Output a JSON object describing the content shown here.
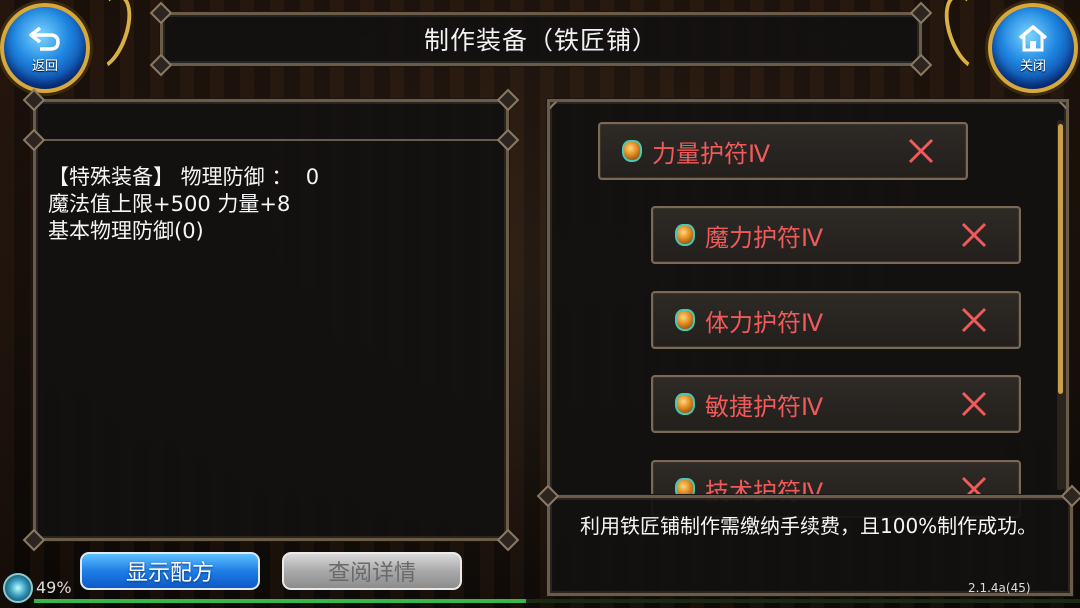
{
  "header": {
    "title": "制作装备（铁匠铺）",
    "back_label": "返回",
    "close_label": "关闭"
  },
  "equipment_info": {
    "lines": [
      "【特殊装备】 物理防御 ：  0",
      "魔法值上限+500 力量+8",
      "基本物理防御(0)"
    ]
  },
  "recipe_list": {
    "items": [
      {
        "name": "力量护符Ⅳ"
      },
      {
        "name": "魔力护符Ⅳ"
      },
      {
        "name": "体力护符Ⅳ"
      },
      {
        "name": "敏捷护符Ⅳ"
      },
      {
        "name": "技术护符Ⅳ"
      }
    ]
  },
  "info_panel": {
    "text": "利用铁匠铺制作需缴纳手续费，且100%制作成功。"
  },
  "buttons": {
    "show_recipe": "显示配方",
    "view_detail": "查阅详情"
  },
  "status": {
    "battery": "49%",
    "progress_fraction": 0.47,
    "version": "2.1.4a(45)"
  },
  "colors": {
    "item_name": "#f05a5a",
    "primary_button": "#1f7ee6",
    "disabled_button": "#a9a9a9",
    "frame": "#6b5c4a"
  },
  "icons": {
    "back": "return-arrow-icon",
    "close": "home-icon",
    "item": "amulet-gem-icon",
    "remove": "close-x-icon"
  }
}
